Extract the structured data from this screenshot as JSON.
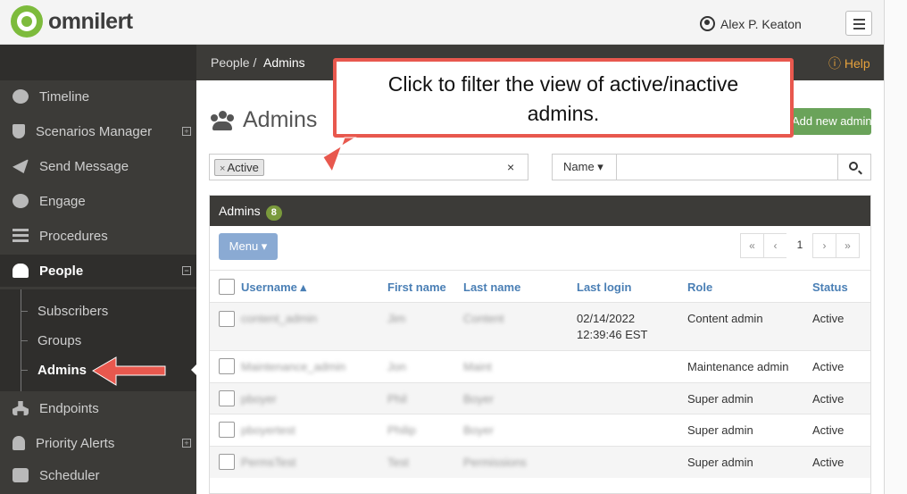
{
  "header": {
    "brand": "omnilert",
    "user_name": "Alex P. Keaton"
  },
  "sidebar": {
    "items": [
      {
        "label": "Timeline",
        "icon": "clock-arrow-icon"
      },
      {
        "label": "Scenarios Manager",
        "icon": "shield-icon"
      },
      {
        "label": "Send Message",
        "icon": "paper-plane-icon"
      },
      {
        "label": "Engage",
        "icon": "chat-bubbles-icon"
      },
      {
        "label": "Procedures",
        "icon": "list-icon"
      },
      {
        "label": "People",
        "icon": "users-icon"
      },
      {
        "label": "Endpoints",
        "icon": "sitemap-icon"
      },
      {
        "label": "Priority Alerts",
        "icon": "bell-icon"
      },
      {
        "label": "Scheduler",
        "icon": "calendar-icon"
      }
    ],
    "sub_items": [
      "Subscribers",
      "Groups",
      "Admins"
    ]
  },
  "breadcrumb": {
    "parent": "People /",
    "current": "Admins",
    "help": "Help"
  },
  "page": {
    "title": "Admins",
    "add_button": "Add new admin"
  },
  "filter": {
    "tag": "Active",
    "clear": "×"
  },
  "search": {
    "field_select": "Name ▾"
  },
  "panel": {
    "title": "Admins",
    "count": "8",
    "menu": "Menu ▾",
    "pager": [
      "«",
      "‹",
      "1",
      "›",
      "»"
    ]
  },
  "table": {
    "headers": [
      "Username ▴",
      "First name",
      "Last name",
      "Last login",
      "Role",
      "Status"
    ],
    "rows": [
      {
        "username": "content_admin",
        "first": "Jim",
        "last": "Content",
        "login_date": "02/14/2022",
        "login_time": "12:39:46 EST",
        "role": "Content admin",
        "status": "Active"
      },
      {
        "username": "Maintenance_admin",
        "first": "Jon",
        "last": "Maint",
        "login_date": "",
        "login_time": "",
        "role": "Maintenance admin",
        "status": "Active"
      },
      {
        "username": "pboyer",
        "first": "Phil",
        "last": "Boyer",
        "login_date": "",
        "login_time": "",
        "role": "Super admin",
        "status": "Active"
      },
      {
        "username": "pboyertest",
        "first": "Philip",
        "last": "Boyer",
        "login_date": "",
        "login_time": "",
        "role": "Super admin",
        "status": "Active"
      },
      {
        "username": "PermsTest",
        "first": "Test",
        "last": "Permissions",
        "login_date": "",
        "login_time": "",
        "role": "Super admin",
        "status": "Active"
      }
    ]
  },
  "callout": {
    "line1": "Click to filter the view of active/inactive",
    "line2": "admins."
  },
  "colors": {
    "accent_red": "#e8584e",
    "add_green": "#6aa35a",
    "sidebar_bg": "#3c3b38",
    "link_blue": "#4a7fb5",
    "help_orange": "#e6a23c"
  }
}
